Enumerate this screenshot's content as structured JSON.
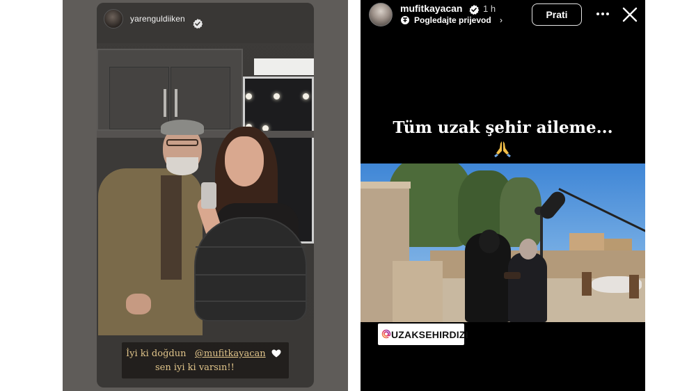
{
  "left_story": {
    "username": "yarenguldiiken",
    "caption": {
      "line1_prefix": "İyi ki doğdun",
      "line1_mention": "@mufitkayacan",
      "line2": "sen iyi ki varsın!!"
    },
    "icons": {
      "avatar": "avatar",
      "verified": "verified-badge-icon",
      "caption_emoji": "white-heart-icon"
    },
    "colors": {
      "caption_text": "#e0c48a",
      "background": "#5f5c59"
    }
  },
  "right_story": {
    "username": "mufitkayacan",
    "time": "1 h",
    "translate_label": "Pogledajte prijevod",
    "follow_label": "Prati",
    "title": "Tüm uzak şehir aileme...",
    "tag": "UZAKSEHIRDIZI",
    "icons": {
      "verified": "verified-badge-icon",
      "translate": "translate-icon",
      "more": "more-options-icon",
      "close": "close-icon",
      "title_emoji": "folded-hands-icon",
      "tag": "at-sign-icon"
    },
    "colors": {
      "background": "#000000",
      "text": "#ffffff"
    }
  }
}
